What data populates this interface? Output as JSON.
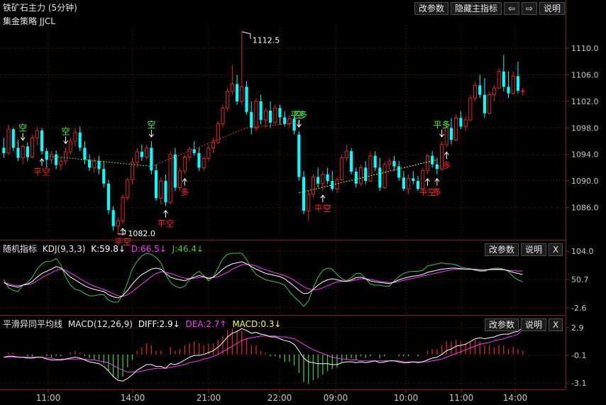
{
  "window": {
    "title": "铁矿石主力 (5分钟)",
    "strategy": "集金策略 JJCL",
    "buttons": {
      "params": "改参数",
      "hide": "隐藏主指标",
      "left": "⇦",
      "right": "⇨",
      "help": "说明"
    }
  },
  "main": {
    "price_labels": [
      "1110.0",
      "1106.0",
      "1102.0",
      "1098.0",
      "1094.0",
      "1090.0",
      "1086.0"
    ],
    "annotations": {
      "high": "1112.5",
      "low": "1082.0"
    },
    "signals": {
      "short": "空",
      "cover": "平空",
      "long": "多",
      "sell": "平多"
    }
  },
  "kdj": {
    "name": "随机指标",
    "params": "KDJ(9,3,3)",
    "k": "K:59.8↓",
    "d": "D:66.5↓",
    "j": "J:46.4↓",
    "axis": [
      "104.0",
      "50.7",
      "-2.6"
    ],
    "buttons": {
      "params": "改参数",
      "help": "说明",
      "close": "X"
    }
  },
  "macd": {
    "name": "平滑异同平均线",
    "params": "MACD(12,26,9)",
    "diff": "DIFF:2.9↓",
    "dea": "DEA:2.7↑",
    "macd": "MACD:0.3↓",
    "axis": [
      "2.9",
      "-0.1",
      "-3.1"
    ],
    "buttons": {
      "params": "改参数",
      "help": "说明",
      "close": "X"
    }
  },
  "time_axis": [
    "11:00",
    "14:00",
    "21:00",
    "22:00",
    "09:00",
    "10:00",
    "11:00",
    "14:00"
  ],
  "colors": {
    "up": "#e02424",
    "down": "#00ffff",
    "grid": "#7a1010",
    "k": "#ffffff",
    "d": "#ff33ff",
    "j": "#33cc33",
    "signal_green": "#33ff33",
    "signal_red": "#ff2020"
  },
  "chart_data": {
    "type": "candlestick",
    "y_range": [
      1082,
      1113
    ],
    "candles": [
      [
        1095.0,
        1096.5,
        1093.5,
        1094.2
      ],
      [
        1094.2,
        1098.5,
        1094.0,
        1097.8
      ],
      [
        1097.8,
        1098.0,
        1094.5,
        1095.0
      ],
      [
        1095.0,
        1096.2,
        1093.0,
        1093.5
      ],
      [
        1093.5,
        1095.5,
        1092.5,
        1095.2
      ],
      [
        1095.2,
        1095.8,
        1093.0,
        1093.6
      ],
      [
        1093.6,
        1097.0,
        1093.4,
        1096.5
      ],
      [
        1096.5,
        1098.2,
        1095.4,
        1097.6
      ],
      [
        1097.6,
        1098.0,
        1094.0,
        1094.5
      ],
      [
        1094.5,
        1095.0,
        1092.0,
        1093.2
      ],
      [
        1093.2,
        1094.5,
        1092.6,
        1094.0
      ],
      [
        1094.0,
        1094.6,
        1091.8,
        1092.4
      ],
      [
        1092.4,
        1093.5,
        1091.6,
        1093.0
      ],
      [
        1093.0,
        1095.0,
        1092.5,
        1094.4
      ],
      [
        1094.4,
        1096.5,
        1094.0,
        1096.0
      ],
      [
        1096.0,
        1098.0,
        1095.2,
        1097.3
      ],
      [
        1097.3,
        1098.2,
        1094.5,
        1095.0
      ],
      [
        1095.0,
        1096.0,
        1092.5,
        1093.2
      ],
      [
        1093.2,
        1094.0,
        1091.5,
        1092.0
      ],
      [
        1092.0,
        1093.5,
        1091.2,
        1093.0
      ],
      [
        1093.0,
        1093.8,
        1091.0,
        1091.8
      ],
      [
        1091.8,
        1093.0,
        1089.0,
        1089.6
      ],
      [
        1089.6,
        1090.2,
        1085.0,
        1085.6
      ],
      [
        1085.6,
        1086.2,
        1082.5,
        1083.2
      ],
      [
        1083.2,
        1084.5,
        1082.0,
        1084.0
      ],
      [
        1084.0,
        1088.0,
        1083.5,
        1087.5
      ],
      [
        1087.5,
        1090.5,
        1087.0,
        1090.2
      ],
      [
        1090.2,
        1093.5,
        1089.5,
        1092.8
      ],
      [
        1092.8,
        1095.0,
        1092.0,
        1094.4
      ],
      [
        1094.4,
        1095.5,
        1093.0,
        1093.6
      ],
      [
        1093.6,
        1095.5,
        1093.2,
        1095.0
      ],
      [
        1095.0,
        1096.0,
        1091.0,
        1091.6
      ],
      [
        1091.6,
        1092.5,
        1087.0,
        1087.4
      ],
      [
        1087.4,
        1090.5,
        1086.5,
        1090.0
      ],
      [
        1090.0,
        1091.0,
        1086.2,
        1086.8
      ],
      [
        1086.8,
        1094.5,
        1086.5,
        1094.0
      ],
      [
        1094.0,
        1095.0,
        1088.5,
        1089.0
      ],
      [
        1089.0,
        1092.0,
        1088.5,
        1091.5
      ],
      [
        1091.5,
        1094.0,
        1091.0,
        1093.6
      ],
      [
        1093.6,
        1095.2,
        1093.0,
        1094.8
      ],
      [
        1094.8,
        1096.0,
        1093.8,
        1094.2
      ],
      [
        1094.2,
        1095.0,
        1091.5,
        1092.0
      ],
      [
        1092.0,
        1093.8,
        1091.5,
        1093.4
      ],
      [
        1093.4,
        1095.5,
        1093.0,
        1095.0
      ],
      [
        1095.0,
        1096.5,
        1094.2,
        1095.8
      ],
      [
        1095.8,
        1099.0,
        1095.5,
        1098.6
      ],
      [
        1098.6,
        1101.5,
        1098.0,
        1101.0
      ],
      [
        1101.0,
        1104.0,
        1100.5,
        1103.5
      ],
      [
        1103.5,
        1107.5,
        1103.0,
        1104.6
      ],
      [
        1104.6,
        1106.0,
        1101.5,
        1102.0
      ],
      [
        1102.0,
        1112.5,
        1101.5,
        1104.2
      ],
      [
        1104.2,
        1105.0,
        1100.0,
        1100.4
      ],
      [
        1100.4,
        1102.0,
        1097.0,
        1098.0
      ],
      [
        1098.0,
        1102.5,
        1097.5,
        1102.0
      ],
      [
        1102.0,
        1103.0,
        1098.5,
        1099.2
      ],
      [
        1099.2,
        1101.0,
        1098.0,
        1100.6
      ],
      [
        1100.6,
        1102.0,
        1098.0,
        1098.8
      ],
      [
        1098.8,
        1101.5,
        1098.5,
        1101.0
      ],
      [
        1101.0,
        1101.5,
        1098.5,
        1099.6
      ],
      [
        1099.6,
        1100.5,
        1098.2,
        1098.6
      ],
      [
        1098.6,
        1100.0,
        1098.0,
        1099.4
      ],
      [
        1099.4,
        1099.8,
        1097.0,
        1097.6
      ],
      [
        1097.0,
        1097.5,
        1090.0,
        1090.6
      ],
      [
        1090.6,
        1091.5,
        1085.0,
        1085.5
      ],
      [
        1085.5,
        1088.5,
        1084.0,
        1088.0
      ],
      [
        1088.0,
        1091.0,
        1087.5,
        1090.6
      ],
      [
        1090.6,
        1092.0,
        1089.0,
        1089.6
      ],
      [
        1089.6,
        1091.5,
        1088.5,
        1091.0
      ],
      [
        1091.0,
        1092.0,
        1089.5,
        1090.0
      ],
      [
        1090.0,
        1091.5,
        1088.5,
        1088.8
      ],
      [
        1088.8,
        1090.5,
        1088.2,
        1090.2
      ],
      [
        1090.2,
        1094.0,
        1090.0,
        1093.5
      ],
      [
        1093.5,
        1095.5,
        1093.0,
        1094.5
      ],
      [
        1094.5,
        1095.0,
        1091.0,
        1091.4
      ],
      [
        1091.4,
        1092.0,
        1089.0,
        1089.6
      ],
      [
        1089.6,
        1092.5,
        1089.2,
        1092.0
      ],
      [
        1092.0,
        1093.0,
        1089.5,
        1090.0
      ],
      [
        1090.0,
        1094.5,
        1089.8,
        1093.8
      ],
      [
        1093.8,
        1094.5,
        1091.5,
        1092.0
      ],
      [
        1092.0,
        1093.5,
        1088.5,
        1089.0
      ],
      [
        1089.0,
        1093.0,
        1088.8,
        1092.5
      ],
      [
        1092.5,
        1093.5,
        1091.5,
        1093.0
      ],
      [
        1093.0,
        1093.8,
        1091.5,
        1092.2
      ],
      [
        1092.2,
        1093.0,
        1090.0,
        1090.5
      ],
      [
        1090.5,
        1091.5,
        1088.5,
        1088.8
      ],
      [
        1088.8,
        1091.0,
        1088.0,
        1090.4
      ],
      [
        1090.4,
        1091.5,
        1089.5,
        1090.0
      ],
      [
        1090.0,
        1090.8,
        1088.5,
        1088.8
      ],
      [
        1088.8,
        1092.0,
        1088.5,
        1091.6
      ],
      [
        1091.6,
        1094.0,
        1091.0,
        1093.8
      ],
      [
        1093.8,
        1094.5,
        1092.0,
        1092.5
      ],
      [
        1092.5,
        1093.5,
        1091.0,
        1091.8
      ],
      [
        1091.8,
        1096.0,
        1091.5,
        1095.5
      ],
      [
        1095.5,
        1098.5,
        1095.0,
        1098.0
      ],
      [
        1098.0,
        1099.5,
        1095.5,
        1096.2
      ],
      [
        1096.2,
        1100.0,
        1096.0,
        1099.5
      ],
      [
        1099.5,
        1100.5,
        1097.8,
        1098.2
      ],
      [
        1098.2,
        1099.8,
        1097.5,
        1099.2
      ],
      [
        1099.2,
        1103.0,
        1099.0,
        1102.5
      ],
      [
        1102.5,
        1105.0,
        1102.0,
        1104.4
      ],
      [
        1104.4,
        1106.0,
        1102.5,
        1103.0
      ],
      [
        1103.0,
        1105.5,
        1099.5,
        1100.2
      ],
      [
        1100.2,
        1103.5,
        1100.0,
        1103.0
      ],
      [
        1103.0,
        1104.5,
        1102.0,
        1104.0
      ],
      [
        1104.0,
        1107.0,
        1103.8,
        1106.5
      ],
      [
        1106.5,
        1109.0,
        1103.5,
        1104.2
      ],
      [
        1104.2,
        1106.5,
        1102.5,
        1103.2
      ],
      [
        1103.2,
        1106.5,
        1103.0,
        1105.8
      ],
      [
        1105.8,
        1108.0,
        1103.2,
        1103.6
      ],
      [
        1103.6,
        1104.0,
        1102.8,
        1103.6
      ]
    ],
    "kdj_range": [
      -2.6,
      104.0
    ],
    "k": [
      45,
      40,
      38,
      36,
      40,
      42,
      47,
      55,
      62,
      66,
      70,
      75,
      72,
      64,
      55,
      50,
      44,
      39,
      35,
      32,
      30,
      28,
      22,
      18,
      16,
      20,
      30,
      42,
      52,
      60,
      65,
      70,
      72,
      70,
      62,
      55,
      52,
      50,
      48,
      52,
      55,
      58,
      56,
      52,
      55,
      62,
      70,
      76,
      80,
      82,
      84,
      80,
      75,
      70,
      66,
      62,
      60,
      58,
      56,
      52,
      45,
      38,
      30,
      24,
      25,
      32,
      40,
      46,
      50,
      52,
      50,
      48,
      47,
      50,
      54,
      55,
      52,
      48,
      46,
      45,
      44,
      43,
      46,
      50,
      53,
      55,
      57,
      58,
      60,
      64,
      66,
      68,
      70,
      71,
      72,
      72,
      71,
      70,
      70,
      69,
      68,
      68,
      69,
      70,
      70,
      69,
      67,
      64,
      62,
      60
    ],
    "d": [
      45,
      43,
      40,
      39,
      40,
      41,
      43,
      48,
      54,
      59,
      63,
      68,
      70,
      68,
      63,
      58,
      52,
      47,
      42,
      38,
      35,
      32,
      28,
      24,
      20,
      19,
      22,
      28,
      35,
      42,
      49,
      56,
      62,
      65,
      64,
      62,
      59,
      56,
      53,
      52,
      53,
      54,
      55,
      54,
      54,
      56,
      60,
      64,
      70,
      74,
      78,
      79,
      78,
      76,
      72,
      69,
      66,
      63,
      61,
      58,
      54,
      49,
      43,
      37,
      33,
      31,
      32,
      35,
      39,
      43,
      46,
      47,
      47,
      48,
      50,
      52,
      52,
      51,
      49,
      47,
      46,
      45,
      45,
      47,
      49,
      51,
      53,
      55,
      57,
      59,
      61,
      63,
      65,
      67,
      69,
      70,
      70,
      70,
      70,
      70,
      69,
      69,
      69,
      69,
      69,
      69,
      68,
      67,
      66.5,
      66.5
    ],
    "j": [
      50,
      35,
      30,
      28,
      40,
      45,
      55,
      70,
      80,
      85,
      85,
      90,
      78,
      55,
      40,
      32,
      30,
      24,
      20,
      20,
      22,
      22,
      12,
      8,
      8,
      22,
      45,
      70,
      85,
      95,
      100,
      98,
      92,
      82,
      60,
      45,
      38,
      35,
      38,
      50,
      60,
      66,
      58,
      48,
      56,
      72,
      90,
      98,
      100,
      100,
      100,
      88,
      72,
      60,
      55,
      50,
      48,
      46,
      44,
      40,
      28,
      18,
      10,
      0,
      10,
      35,
      55,
      68,
      72,
      70,
      60,
      52,
      48,
      54,
      62,
      62,
      52,
      42,
      40,
      40,
      38,
      38,
      48,
      56,
      62,
      65,
      66,
      66,
      68,
      76,
      78,
      80,
      82,
      80,
      80,
      78,
      74,
      72,
      71,
      68,
      66,
      66,
      70,
      72,
      72,
      70,
      66,
      56,
      50,
      46.4
    ],
    "macd_range": [
      -3.1,
      2.9
    ],
    "diff": [
      -0.3,
      -0.2,
      -0.2,
      -0.3,
      -0.3,
      -0.4,
      -0.4,
      -0.3,
      -0.3,
      -0.5,
      -0.6,
      -0.6,
      -0.6,
      -0.5,
      -0.4,
      -0.3,
      -0.4,
      -0.6,
      -0.8,
      -0.9,
      -1.0,
      -1.3,
      -1.8,
      -2.4,
      -2.8,
      -2.9,
      -2.6,
      -2.2,
      -1.7,
      -1.4,
      -1.1,
      -1.1,
      -1.3,
      -1.3,
      -1.5,
      -1.0,
      -1.1,
      -0.9,
      -0.6,
      -0.3,
      -0.1,
      -0.1,
      0.0,
      0.2,
      0.4,
      0.8,
      1.3,
      1.9,
      2.3,
      2.5,
      2.8,
      2.6,
      2.3,
      2.4,
      2.2,
      2.1,
      1.9,
      1.9,
      1.7,
      1.5,
      1.4,
      1.1,
      0.4,
      -0.4,
      -0.8,
      -0.9,
      -1.0,
      -1.0,
      -1.0,
      -1.1,
      -1.1,
      -0.9,
      -0.8,
      -0.8,
      -0.9,
      -0.8,
      -0.9,
      -0.8,
      -0.7,
      -0.9,
      -0.8,
      -0.7,
      -0.7,
      -0.8,
      -0.9,
      -0.9,
      -0.8,
      -0.9,
      -0.8,
      -0.6,
      -0.4,
      -0.3,
      0.0,
      0.4,
      0.6,
      0.9,
      1.0,
      1.1,
      1.4,
      1.7,
      1.8,
      1.7,
      1.8,
      1.9,
      2.1,
      2.2,
      2.2,
      2.4,
      2.5,
      2.9
    ],
    "dea": [
      -0.3,
      -0.3,
      -0.3,
      -0.3,
      -0.3,
      -0.3,
      -0.3,
      -0.3,
      -0.3,
      -0.4,
      -0.4,
      -0.5,
      -0.5,
      -0.5,
      -0.5,
      -0.5,
      -0.5,
      -0.5,
      -0.6,
      -0.6,
      -0.7,
      -0.8,
      -0.9,
      -1.2,
      -1.5,
      -1.7,
      -1.9,
      -1.9,
      -1.9,
      -1.8,
      -1.7,
      -1.6,
      -1.5,
      -1.5,
      -1.5,
      -1.4,
      -1.3,
      -1.2,
      -1.1,
      -0.9,
      -0.8,
      -0.7,
      -0.5,
      -0.4,
      -0.2,
      0.0,
      0.3,
      0.6,
      0.9,
      1.2,
      1.5,
      1.7,
      1.8,
      1.9,
      2.0,
      2.0,
      2.0,
      2.0,
      1.9,
      1.9,
      1.8,
      1.7,
      1.4,
      1.1,
      0.8,
      0.5,
      0.3,
      0.1,
      -0.1,
      -0.3,
      -0.4,
      -0.5,
      -0.5,
      -0.6,
      -0.6,
      -0.7,
      -0.7,
      -0.7,
      -0.7,
      -0.7,
      -0.7,
      -0.7,
      -0.7,
      -0.7,
      -0.8,
      -0.8,
      -0.8,
      -0.8,
      -0.8,
      -0.8,
      -0.7,
      -0.6,
      -0.5,
      -0.3,
      -0.1,
      0.1,
      0.3,
      0.5,
      0.7,
      0.9,
      1.1,
      1.2,
      1.3,
      1.5,
      1.6,
      1.7,
      1.9,
      2.0,
      2.2,
      2.7
    ]
  }
}
